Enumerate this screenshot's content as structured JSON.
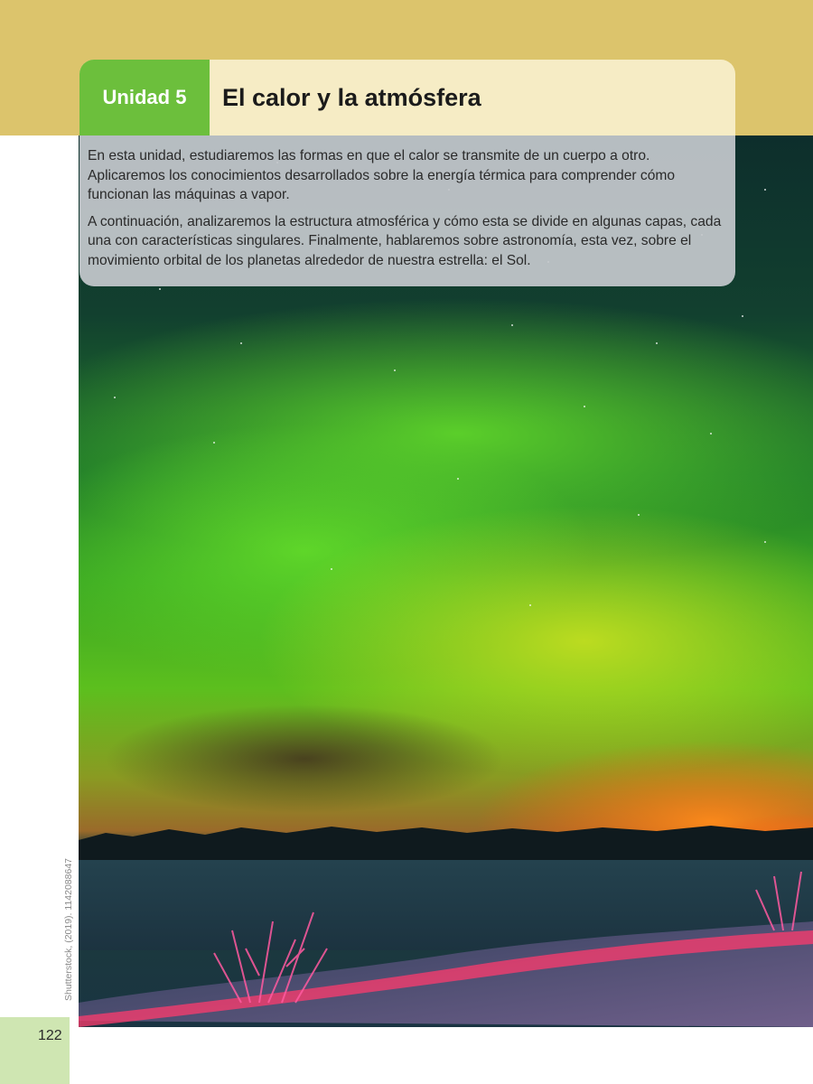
{
  "header": {
    "unit_label": "Unidad 5",
    "title": "El calor y la atmósfera"
  },
  "intro": {
    "paragraphs": [
      "En esta unidad, estudiaremos las formas en que el calor se transmite de un cuerpo a otro. Aplicaremos los conocimientos desarrollados sobre la energía térmica para comprender cómo funcionan las máquinas a vapor.",
      "A continuación, analizaremos la estructura atmosférica y cómo esta se divide en algunas capas, cada una con características singulares. Finalmente, hablaremos sobre astronomía, esta vez, sobre el movimiento orbital de los planetas alrededor de nuestra estrella: el Sol."
    ]
  },
  "photo": {
    "credit": "Shutterstock, (2019). 1142088647",
    "subject": "aurora-borealis-photo"
  },
  "footer": {
    "page_number": "122"
  },
  "colors": {
    "top_band": "#dcc46c",
    "unit_tab": "#6cbf3c",
    "title_bar": "#f6ecc5",
    "page_tab": "#cfe6b2"
  }
}
